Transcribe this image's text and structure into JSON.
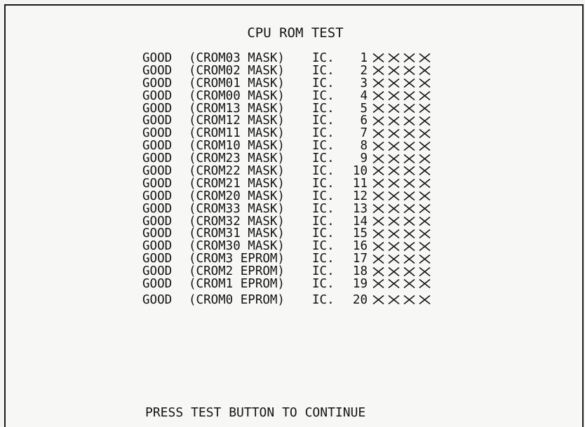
{
  "screen": {
    "title": "CPU ROM TEST",
    "rows": [
      {
        "status": "GOOD",
        "chip": "(CROM03 MASK)",
        "ic_label": "IC.",
        "ic_number": "1",
        "result": "XXXX"
      },
      {
        "status": "GOOD",
        "chip": "(CROM02 MASK)",
        "ic_label": "IC.",
        "ic_number": "2",
        "result": "XXXX"
      },
      {
        "status": "GOOD",
        "chip": "(CROM01 MASK)",
        "ic_label": "IC.",
        "ic_number": "3",
        "result": "XXXX"
      },
      {
        "status": "GOOD",
        "chip": "(CROM00 MASK)",
        "ic_label": "IC.",
        "ic_number": "4",
        "result": "XXXX"
      },
      {
        "status": "GOOD",
        "chip": "(CROM13 MASK)",
        "ic_label": "IC.",
        "ic_number": "5",
        "result": "XXXX"
      },
      {
        "status": "GOOD",
        "chip": "(CROM12 MASK)",
        "ic_label": "IC.",
        "ic_number": "6",
        "result": "XXXX"
      },
      {
        "status": "GOOD",
        "chip": "(CROM11 MASK)",
        "ic_label": "IC.",
        "ic_number": "7",
        "result": "XXXX"
      },
      {
        "status": "GOOD",
        "chip": "(CROM10 MASK)",
        "ic_label": "IC.",
        "ic_number": "8",
        "result": "XXXX"
      },
      {
        "status": "GOOD",
        "chip": "(CROM23 MASK)",
        "ic_label": "IC.",
        "ic_number": "9",
        "result": "XXXX"
      },
      {
        "status": "GOOD",
        "chip": "(CROM22 MASK)",
        "ic_label": "IC.",
        "ic_number": "10",
        "result": "XXXX"
      },
      {
        "status": "GOOD",
        "chip": "(CROM21 MASK)",
        "ic_label": "IC.",
        "ic_number": "11",
        "result": "XXXX"
      },
      {
        "status": "GOOD",
        "chip": "(CROM20 MASK)",
        "ic_label": "IC.",
        "ic_number": "12",
        "result": "XXXX"
      },
      {
        "status": "GOOD",
        "chip": "(CROM33 MASK)",
        "ic_label": "IC.",
        "ic_number": "13",
        "result": "XXXX"
      },
      {
        "status": "GOOD",
        "chip": "(CROM32 MASK)",
        "ic_label": "IC.",
        "ic_number": "14",
        "result": "XXXX"
      },
      {
        "status": "GOOD",
        "chip": "(CROM31 MASK)",
        "ic_label": "IC.",
        "ic_number": "15",
        "result": "XXXX"
      },
      {
        "status": "GOOD",
        "chip": "(CROM30 MASK)",
        "ic_label": "IC.",
        "ic_number": "16",
        "result": "XXXX"
      },
      {
        "status": "GOOD",
        "chip": "(CROM3 EPROM)",
        "ic_label": "IC.",
        "ic_number": "17",
        "result": "XXXX"
      },
      {
        "status": "GOOD",
        "chip": "(CROM2 EPROM)",
        "ic_label": "IC.",
        "ic_number": "18",
        "result": "XXXX"
      },
      {
        "status": "GOOD",
        "chip": "(CROM1 EPROM)",
        "ic_label": "IC.",
        "ic_number": "19",
        "result": "XXXX"
      },
      {
        "status": "GOOD",
        "chip": "(CROM0 EPROM)",
        "ic_label": "IC.",
        "ic_number": "20",
        "result": "XXXX"
      }
    ],
    "footer": "PRESS TEST BUTTON TO CONTINUE"
  },
  "colors": {
    "text": "#141414",
    "background": "#f7f7f5",
    "border": "#1a1a1a"
  }
}
